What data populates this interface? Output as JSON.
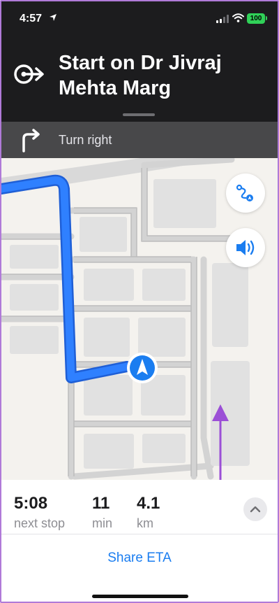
{
  "status_bar": {
    "time": "4:57",
    "battery": "100",
    "icons": [
      "location-arrow-icon",
      "cellular-signal-icon",
      "wifi-icon",
      "battery-icon"
    ]
  },
  "navigation": {
    "primary_instruction": "Start on Dr Jivraj Mehta Marg",
    "primary_icon": "start-arrow-icon",
    "next_step_label": "Turn right",
    "next_step_icon": "turn-right-icon"
  },
  "map": {
    "buttons": [
      "route-overview-icon",
      "speaker-icon"
    ],
    "route_color": "#2f80ff",
    "marker_color": "#1a7df0"
  },
  "trip": {
    "eta": {
      "value": "5:08",
      "label": "next stop"
    },
    "duration": {
      "value": "11",
      "label": "min"
    },
    "distance": {
      "value": "4.1",
      "label": "km"
    },
    "share_label": "Share ETA"
  },
  "colors": {
    "header_bg": "#1c1c1e",
    "next_step_bg": "#48484a",
    "accent": "#1a7df0",
    "annotation_arrow": "#9b4fd6"
  }
}
